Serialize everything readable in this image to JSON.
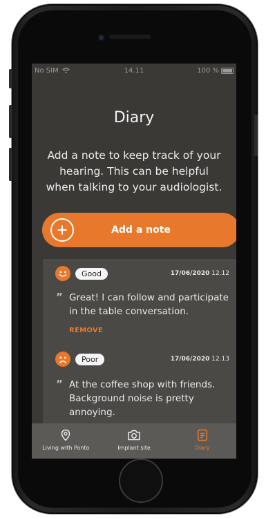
{
  "status_bar": {
    "carrier": "No SIM",
    "time": "14.11",
    "battery": "100 %"
  },
  "page": {
    "title": "Diary",
    "intro": "Add a note to keep track of your hearing. This can be helpful when talking to your audiologist."
  },
  "add_note": {
    "label": "Add a note",
    "icon": "plus-icon"
  },
  "entries": [
    {
      "mood": "Good",
      "icon": "smile-face-icon",
      "date": "17/06/2020",
      "time": "12.12",
      "text": "Great! I can follow and participate in the table conversation.",
      "remove_label": "REMOVE"
    },
    {
      "mood": "Poor",
      "icon": "sad-face-icon",
      "date": "17/06/2020",
      "time": "12.13",
      "text": "At the coffee shop with friends. Background noise is pretty annoying."
    }
  ],
  "quote_glyph": "”",
  "tabs": [
    {
      "label": "Living with Ponto",
      "icon": "location-pin-icon",
      "active": false
    },
    {
      "label": "Implant site",
      "icon": "camera-icon",
      "active": false
    },
    {
      "label": "Diary",
      "icon": "notepad-icon",
      "active": true
    }
  ],
  "colors": {
    "accent": "#e8782b",
    "background": "#3a3936",
    "card": "#4a4946",
    "tab_bar": "#5b5a57"
  }
}
